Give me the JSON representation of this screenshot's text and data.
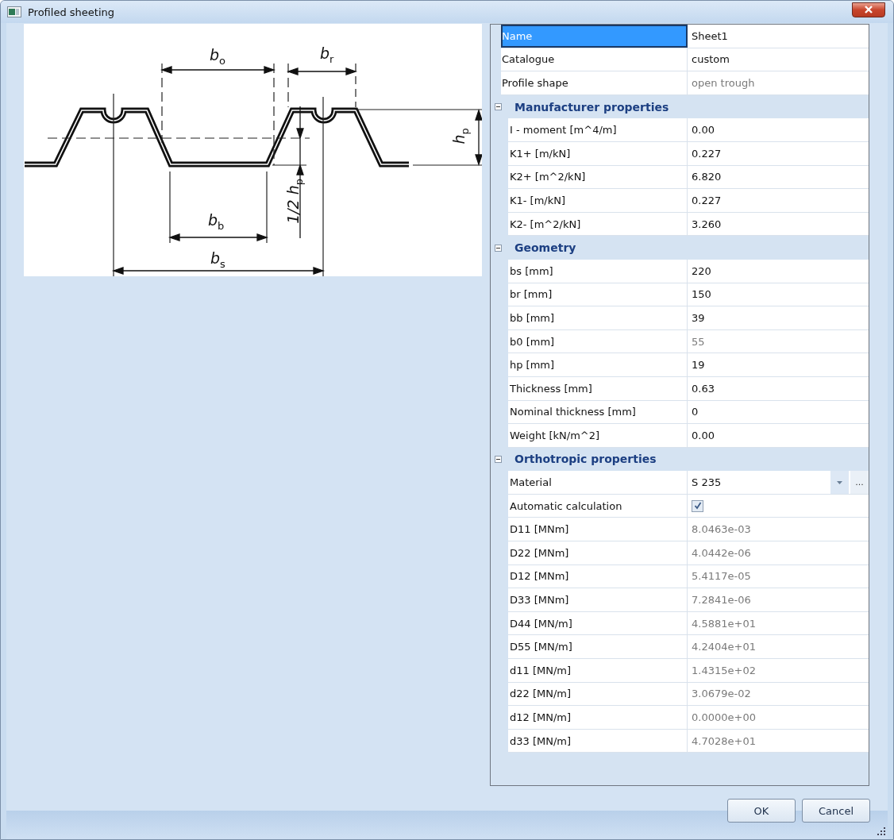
{
  "window": {
    "title": "Profiled sheeting"
  },
  "diagram": {
    "labels": [
      {
        "kind": "bo",
        "text": "b$_{o}$"
      },
      {
        "kind": "br",
        "text": "b$_{r}$"
      },
      {
        "kind": "hp",
        "text": "h$_{p}$"
      },
      {
        "kind": "half_hp",
        "text": "1/2 h$_{p}$"
      },
      {
        "kind": "bb",
        "text": "b$_{b}$"
      },
      {
        "kind": "bs",
        "text": "b$_{s}$"
      }
    ]
  },
  "properties": [
    {
      "kind": "row",
      "label": "Name",
      "value": "Sheet1",
      "selected": true,
      "readonly": false
    },
    {
      "kind": "row",
      "label": "Catalogue",
      "value": "custom",
      "selected": false,
      "readonly": false
    },
    {
      "kind": "row",
      "label": "Profile shape",
      "value": "open trough",
      "selected": false,
      "readonly": true
    },
    {
      "kind": "group",
      "label": "Manufacturer properties",
      "expanded": true,
      "children": [
        {
          "kind": "row",
          "label": "I - moment [m^4/m]",
          "value": "0.00",
          "selected": false,
          "readonly": false
        },
        {
          "kind": "row",
          "label": "K1+ [m/kN]",
          "value": "0.227",
          "selected": false,
          "readonly": false
        },
        {
          "kind": "row",
          "label": "K2+ [m^2/kN]",
          "value": "6.820",
          "selected": false,
          "readonly": false
        },
        {
          "kind": "row",
          "label": "K1- [m/kN]",
          "value": "0.227",
          "selected": false,
          "readonly": false
        },
        {
          "kind": "row",
          "label": "K2- [m^2/kN]",
          "value": "3.260",
          "selected": false,
          "readonly": false
        }
      ]
    },
    {
      "kind": "group",
      "label": "Geometry",
      "expanded": true,
      "children": [
        {
          "kind": "row",
          "label": "bs [mm]",
          "value": "220",
          "selected": false,
          "readonly": false
        },
        {
          "kind": "row",
          "label": "br [mm]",
          "value": "150",
          "selected": false,
          "readonly": false
        },
        {
          "kind": "row",
          "label": "bb [mm]",
          "value": "39",
          "selected": false,
          "readonly": false
        },
        {
          "kind": "row",
          "label": "b0 [mm]",
          "value": "55",
          "selected": false,
          "readonly": true
        },
        {
          "kind": "row",
          "label": "hp [mm]",
          "value": "19",
          "selected": false,
          "readonly": false
        },
        {
          "kind": "row",
          "label": "Thickness [mm]",
          "value": "0.63",
          "selected": false,
          "readonly": false
        },
        {
          "kind": "row",
          "label": "Nominal thickness [mm]",
          "value": "0",
          "selected": false,
          "readonly": false
        },
        {
          "kind": "row",
          "label": "Weight [kN/m^2]",
          "value": "0.00",
          "selected": false,
          "readonly": false
        }
      ]
    },
    {
      "kind": "group",
      "label": "Orthotropic properties",
      "expanded": true,
      "children": [
        {
          "kind": "dropdown",
          "label": "Material",
          "value": "S 235",
          "selected": false,
          "readonly": false,
          "more": "..."
        },
        {
          "kind": "checkbox",
          "label": "Automatic calculation",
          "checked": true,
          "selected": false
        },
        {
          "kind": "row",
          "label": "D11 [MNm]",
          "value": "8.0463e-03",
          "selected": false,
          "readonly": true
        },
        {
          "kind": "row",
          "label": "D22 [MNm]",
          "value": "4.0442e-06",
          "selected": false,
          "readonly": true
        },
        {
          "kind": "row",
          "label": "D12 [MNm]",
          "value": "5.4117e-05",
          "selected": false,
          "readonly": true
        },
        {
          "kind": "row",
          "label": "D33 [MNm]",
          "value": "7.2841e-06",
          "selected": false,
          "readonly": true
        },
        {
          "kind": "row",
          "label": "D44 [MN/m]",
          "value": "4.5881e+01",
          "selected": false,
          "readonly": true
        },
        {
          "kind": "row",
          "label": "D55 [MN/m]",
          "value": "4.2404e+01",
          "selected": false,
          "readonly": true
        },
        {
          "kind": "row",
          "label": "d11 [MN/m]",
          "value": "1.4315e+02",
          "selected": false,
          "readonly": true
        },
        {
          "kind": "row",
          "label": "d22 [MN/m]",
          "value": "3.0679e-02",
          "selected": false,
          "readonly": true
        },
        {
          "kind": "row",
          "label": "d12 [MN/m]",
          "value": "0.0000e+00",
          "selected": false,
          "readonly": true
        },
        {
          "kind": "row",
          "label": "d33 [MN/m]",
          "value": "4.7028e+01",
          "selected": false,
          "readonly": true
        }
      ]
    }
  ],
  "buttons": [
    "OK",
    "Cancel"
  ]
}
